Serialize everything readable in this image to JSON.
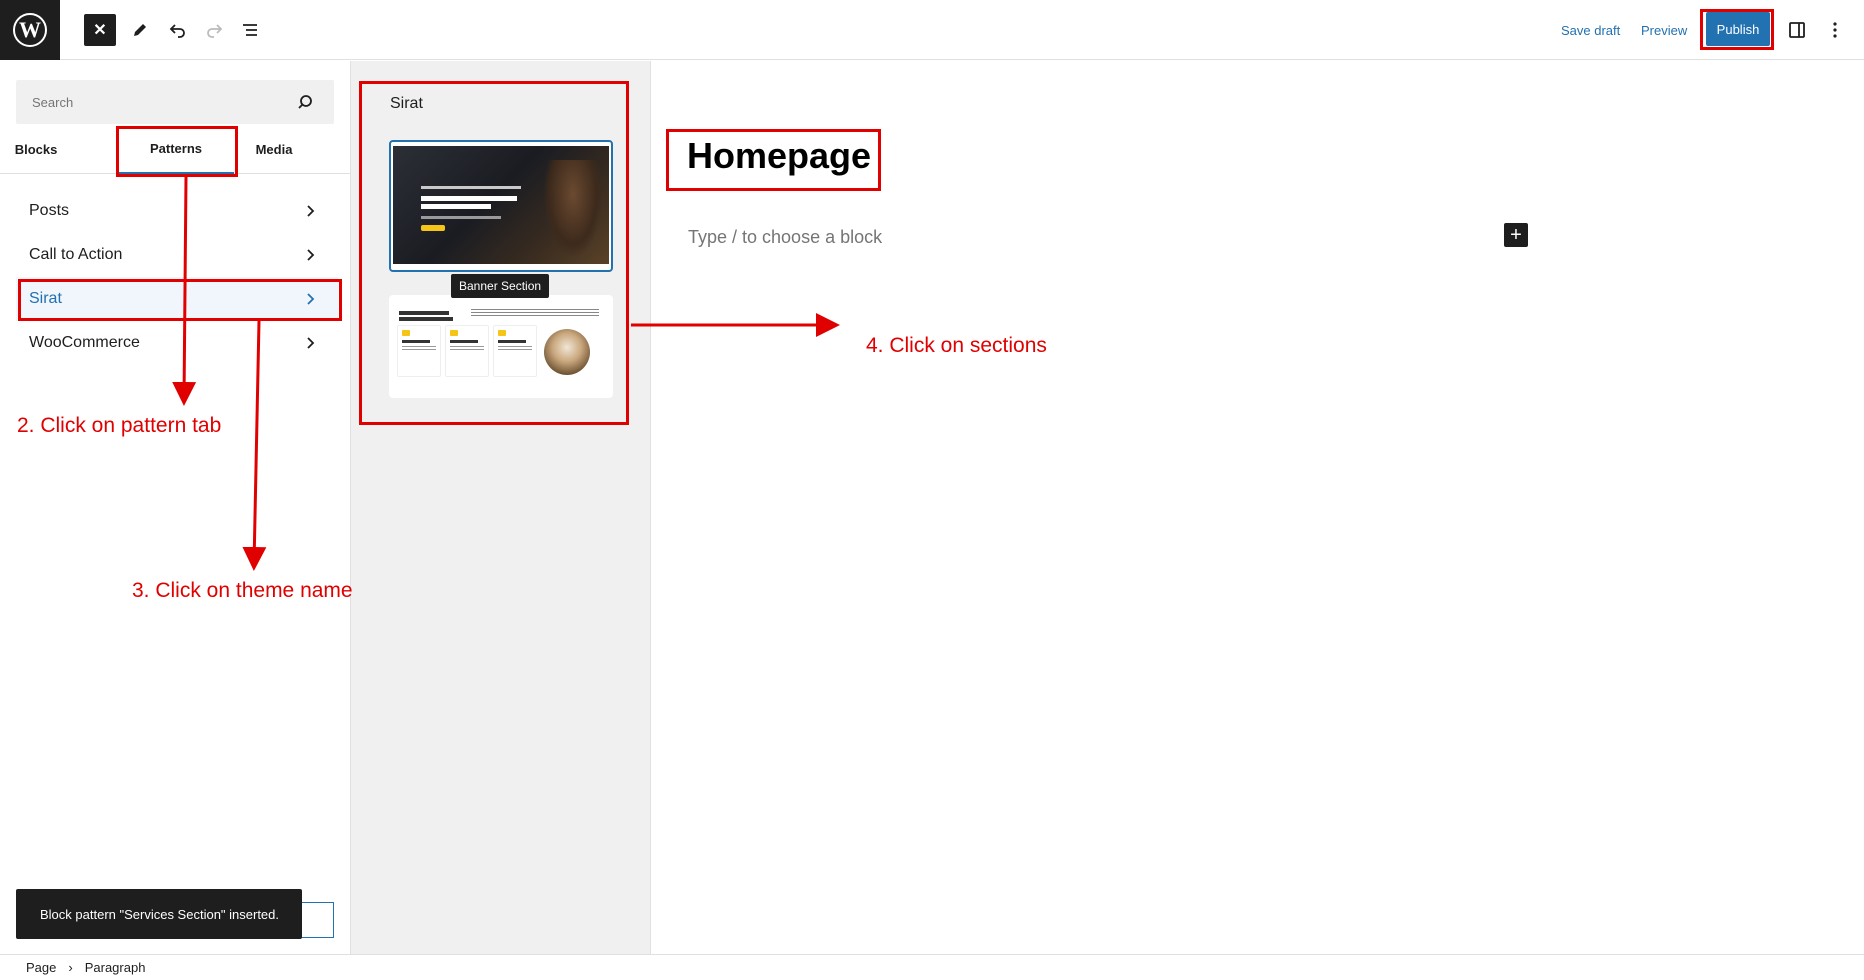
{
  "toolbar": {
    "save_draft": "Save draft",
    "preview": "Preview",
    "publish": "Publish",
    "icons": [
      "wordpress-logo",
      "close-icon",
      "pencil-icon",
      "undo-icon",
      "redo-icon",
      "list-view-icon",
      "sidebar-toggle-icon",
      "more-options-icon"
    ]
  },
  "inserter": {
    "search_placeholder": "Search",
    "tabs": [
      {
        "label": "Blocks"
      },
      {
        "label": "Patterns",
        "active": true
      },
      {
        "label": "Media"
      }
    ],
    "categories": [
      {
        "label": "Posts"
      },
      {
        "label": "Call to Action"
      },
      {
        "label": "Sirat",
        "selected": true
      },
      {
        "label": "WooCommerce"
      }
    ],
    "toast": "Block pattern \"Services Section\" inserted."
  },
  "pattern_panel": {
    "title": "Sirat",
    "tooltip": "Banner Section",
    "banner_preview": {
      "line1": "TE OBTINUIT UT ADEPTO SATIS",
      "line2": "SOMNO ALISQUE"
    },
    "services_preview": {
      "heading": "OUR AWESOME SERVICES",
      "cards": [
        "Services Title 1",
        "Services Title 2",
        "Services Title 3"
      ]
    }
  },
  "editor": {
    "page_title": "Homepage",
    "block_placeholder": "Type / to choose a block"
  },
  "breadcrumb": {
    "items": [
      "Page",
      "Paragraph"
    ]
  },
  "annotations": {
    "step2": "2. Click on pattern tab",
    "step3": "3. Click on theme name",
    "step4": "4. Click on sections",
    "color": "#e00000"
  },
  "colors": {
    "accent": "#2271b1",
    "dark": "#1e1e1e",
    "panel_bg": "#f0f0f0"
  }
}
